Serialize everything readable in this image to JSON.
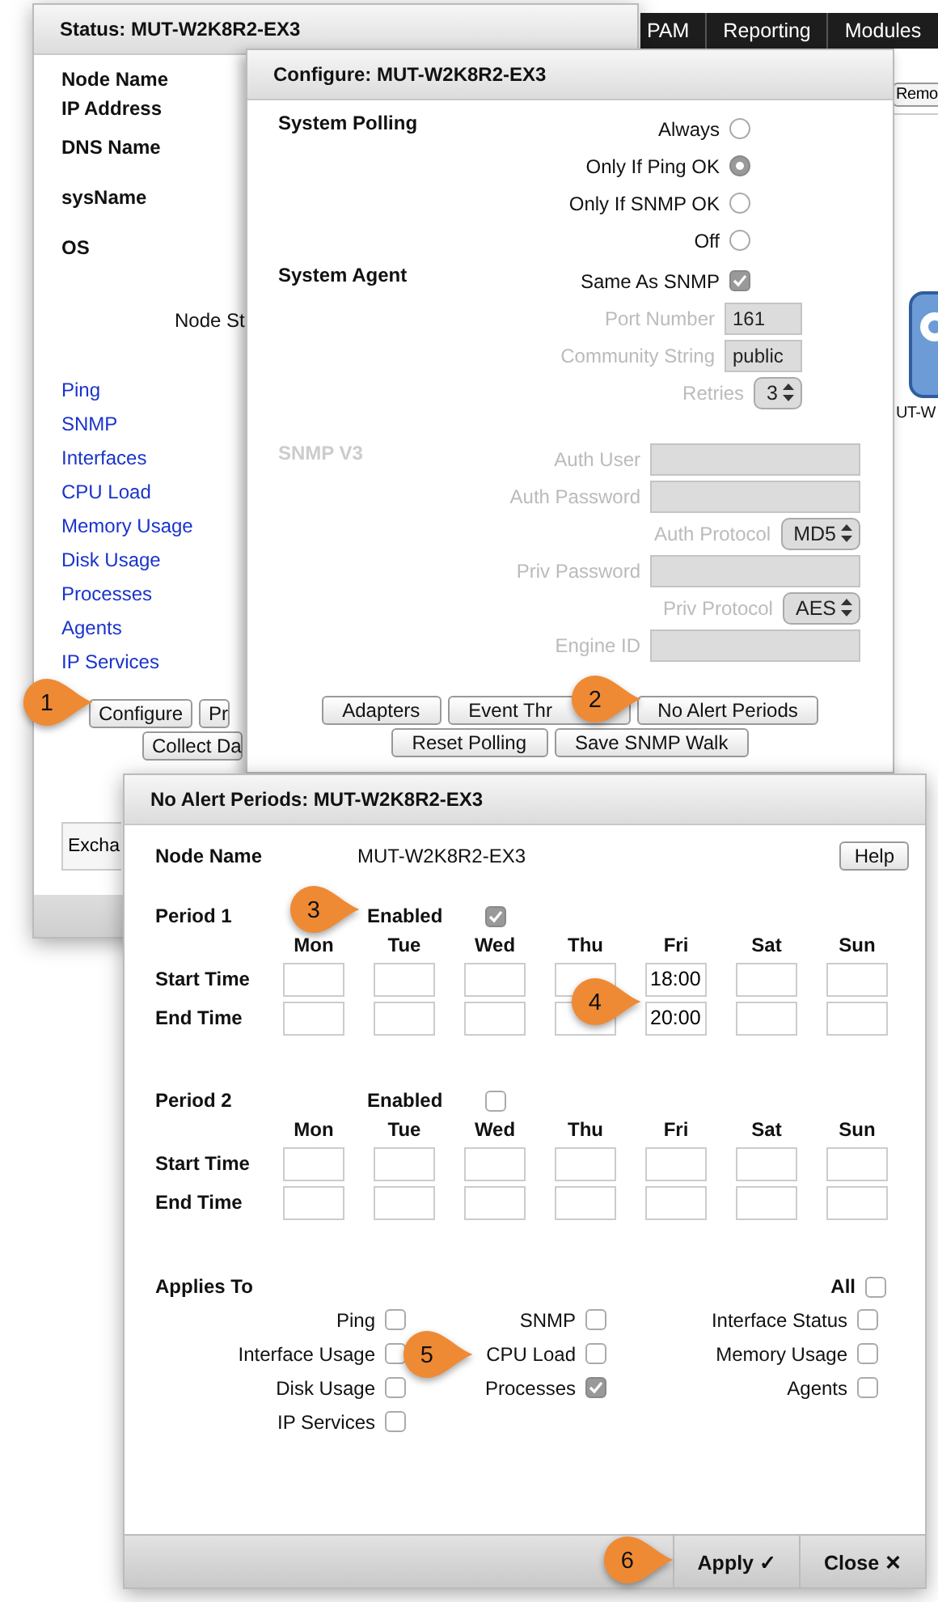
{
  "top_nav": {
    "items": [
      "PAM",
      "Reporting",
      "Modules"
    ]
  },
  "toolbar": {
    "button": "Remo"
  },
  "map_node": {
    "label": "UT-W"
  },
  "status_window": {
    "title": "Status: MUT-W2K8R2-EX3",
    "fields": [
      "Node Name",
      "IP Address",
      "DNS Name",
      "sysName",
      "OS"
    ],
    "node_status_label": "Node St",
    "links": [
      "Ping",
      "SNMP",
      "Interfaces",
      "CPU Load",
      "Memory Usage",
      "Disk Usage",
      "Processes",
      "Agents",
      "IP Services"
    ],
    "buttons": [
      [
        "Configure",
        "Pr"
      ],
      [
        "Collect Da"
      ]
    ],
    "search_value": "Excha"
  },
  "configure_window": {
    "title": "Configure: MUT-W2K8R2-EX3",
    "sections": [
      {
        "label": "System Polling",
        "disabled": false,
        "items": [
          {
            "kind": "radio",
            "label": "Always",
            "selected": false,
            "disabled": false
          },
          {
            "kind": "radio",
            "label": "Only If Ping OK",
            "selected": true,
            "disabled": false
          },
          {
            "kind": "radio",
            "label": "Only If SNMP OK",
            "selected": false,
            "disabled": false
          },
          {
            "kind": "radio",
            "label": "Off",
            "selected": false,
            "disabled": false
          }
        ]
      },
      {
        "label": "System Agent",
        "disabled": false,
        "items": [
          {
            "kind": "checkbox",
            "label": "Same As SNMP",
            "checked": true,
            "disabled": false
          },
          {
            "kind": "input",
            "label": "Port Number",
            "value": "161",
            "disabled": true
          },
          {
            "kind": "input",
            "label": "Community String",
            "value": "public",
            "disabled": true
          },
          {
            "kind": "select",
            "label": "Retries",
            "value": "3",
            "disabled": true
          }
        ]
      },
      {
        "label": "SNMP V3",
        "disabled": true,
        "items": [
          {
            "kind": "input",
            "label": "Auth User",
            "disabled": true
          },
          {
            "kind": "input",
            "label": "Auth Password",
            "disabled": true
          },
          {
            "kind": "select",
            "label": "Auth Protocol",
            "value": "MD5",
            "disabled": true
          },
          {
            "kind": "input",
            "label": "Priv Password",
            "disabled": true
          },
          {
            "kind": "select",
            "label": "Priv Protocol",
            "value": "AES",
            "disabled": true
          },
          {
            "kind": "input",
            "label": "Engine ID",
            "disabled": true
          }
        ]
      }
    ],
    "buttons": [
      [
        "Adapters",
        "Event Thr",
        "No Alert Periods"
      ],
      [
        "Reset Polling",
        "Save SNMP Walk"
      ]
    ]
  },
  "no_alert_window": {
    "title": "No Alert Periods: MUT-W2K8R2-EX3",
    "node_label": "Node Name",
    "node_value": "MUT-W2K8R2-EX3",
    "help": "Help",
    "periods": [
      {
        "label": "Period 1",
        "enabled_label": "Enabled",
        "enabled": true,
        "row_labels": [
          "Start Time",
          "End Time"
        ],
        "days": [
          {
            "label": "Mon"
          },
          {
            "label": "Tue"
          },
          {
            "label": "Wed"
          },
          {
            "label": "Thu"
          },
          {
            "label": "Fri",
            "start_time": "18:00",
            "end_time": "20:00"
          },
          {
            "label": "Sat"
          },
          {
            "label": "Sun"
          }
        ]
      },
      {
        "label": "Period 2",
        "enabled_label": "Enabled",
        "enabled": false,
        "row_labels": [
          "Start Time",
          "End Time"
        ],
        "days": [
          {
            "label": "Mon"
          },
          {
            "label": "Tue"
          },
          {
            "label": "Wed"
          },
          {
            "label": "Thu"
          },
          {
            "label": "Fri"
          },
          {
            "label": "Sat"
          },
          {
            "label": "Sun"
          }
        ]
      }
    ],
    "applies_to": {
      "label": "Applies To",
      "all": {
        "label": "All",
        "checked": false
      },
      "items": [
        {
          "label": "Ping",
          "checked": false
        },
        {
          "label": "SNMP",
          "checked": false
        },
        {
          "label": "Interface Status",
          "checked": false
        },
        {
          "label": "Interface Usage",
          "checked": false
        },
        {
          "label": "CPU Load",
          "checked": false
        },
        {
          "label": "Memory Usage",
          "checked": false
        },
        {
          "label": "Disk Usage",
          "checked": false
        },
        {
          "label": "Processes",
          "checked": true
        },
        {
          "label": "Agents",
          "checked": false
        },
        {
          "label": "IP Services",
          "checked": false
        }
      ]
    },
    "footer_buttons": [
      "Apply ✓",
      "Close ✕"
    ]
  },
  "callouts": [
    "1",
    "2",
    "3",
    "4",
    "5",
    "6"
  ]
}
